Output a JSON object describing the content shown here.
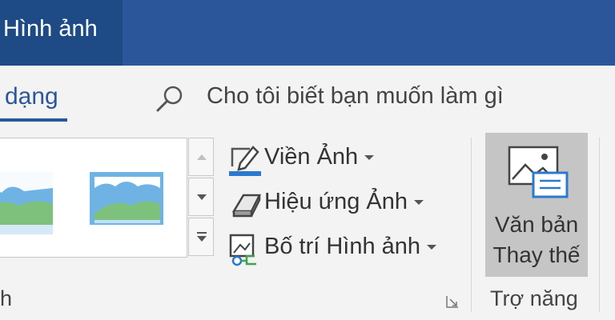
{
  "titlebar": {
    "contextual_tab": "Hình ảnh"
  },
  "tabs": {
    "active": "dạng"
  },
  "search": {
    "placeholder": "Cho tôi biết bạn muốn làm gì",
    "icon": "search-icon"
  },
  "picture_styles": {
    "group_label_partial": "h",
    "scroll_up": "scroll-up-icon",
    "scroll_down": "scroll-down-icon",
    "more": "gallery-more-icon"
  },
  "commands": [
    {
      "label": "Viền Ảnh",
      "icon": "picture-border-icon"
    },
    {
      "label": "Hiệu ứng Ảnh",
      "icon": "picture-effects-icon"
    },
    {
      "label": "Bố trí Hình ảnh",
      "icon": "picture-layout-icon"
    }
  ],
  "accessibility": {
    "alt_text_line1": "Văn bản",
    "alt_text_line2": "Thay thế",
    "group_label": "Trợ năng",
    "icon": "alt-text-icon"
  },
  "colors": {
    "title_bar": "#2b579a",
    "contextual_tab": "#1e4a86",
    "ribbon_bg": "#f3f3f3",
    "selected_button": "#c5c5c5"
  }
}
